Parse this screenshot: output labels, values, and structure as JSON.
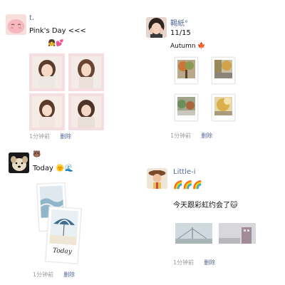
{
  "posts": [
    {
      "username": "t.",
      "text": "Pink's Day <<<",
      "emoji_line": "👧💕",
      "time": "1分钟前",
      "delete_label": "删除",
      "avatar_icon": "pink-blush-face-icon",
      "photos": [
        "portrait-photo",
        "portrait-photo",
        "portrait-photo",
        "portrait-photo"
      ]
    },
    {
      "username": "鞨紙°",
      "text": "11/15",
      "emoji_line": "Autumn 🍁",
      "time": "1分钟前",
      "delete_label": "删除",
      "avatar_icon": "girl-hands-face-icon",
      "photos": [
        "autumn-tree-polaroid",
        "autumn-street-polaroid",
        "autumn-scene-polaroid",
        "autumn-leaf-polaroid"
      ]
    },
    {
      "username": "🐻",
      "text": "Today 🌞🌊",
      "time": "1分钟前",
      "delete_label": "删除",
      "avatar_icon": "puppy-icon",
      "photo_caption": "Today",
      "photos": [
        "sea-polaroid",
        "beach-umbrella-polaroid"
      ]
    },
    {
      "username": "Little-i",
      "text": "🌈🌈🌈",
      "emoji_line": "今天跟彩虹约会了🐱",
      "time": "1分钟前",
      "delete_label": "删除",
      "avatar_icon": "woody-toy-icon",
      "photos": [
        "bridge-sky-photo",
        "building-sky-photo"
      ]
    }
  ],
  "colors": {
    "link": "#576b95",
    "meta": "#9a9a9a",
    "pink": "#f6dde2"
  }
}
